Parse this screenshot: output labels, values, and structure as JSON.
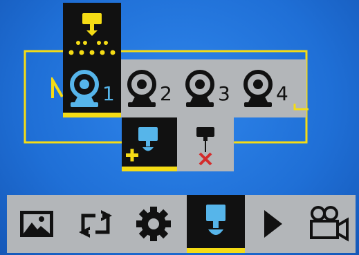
{
  "cameras": [
    {
      "label": "1",
      "selected": true
    },
    {
      "label": "2",
      "selected": false
    },
    {
      "label": "3",
      "selected": false
    },
    {
      "label": "4",
      "selected": false
    }
  ],
  "submenu": {
    "items": [
      {
        "icon": "add-preset-icon",
        "selected": true
      },
      {
        "icon": "delete-preset-icon",
        "selected": false
      }
    ]
  },
  "toolbar": {
    "tabs": [
      {
        "icon": "image-icon",
        "selected": false
      },
      {
        "icon": "cycle-icon",
        "selected": false
      },
      {
        "icon": "gear-icon",
        "selected": false
      },
      {
        "icon": "preset-icon",
        "selected": true
      },
      {
        "icon": "play-icon",
        "selected": false
      },
      {
        "icon": "video-camera-icon",
        "selected": false
      }
    ]
  },
  "colors": {
    "background": "#1f6fd9",
    "panel": "#b3b6b9",
    "selected_bg": "#111111",
    "accent_yellow": "#f5dc15",
    "accent_blue": "#56b5ea",
    "delete_red": "#d42b2b"
  }
}
